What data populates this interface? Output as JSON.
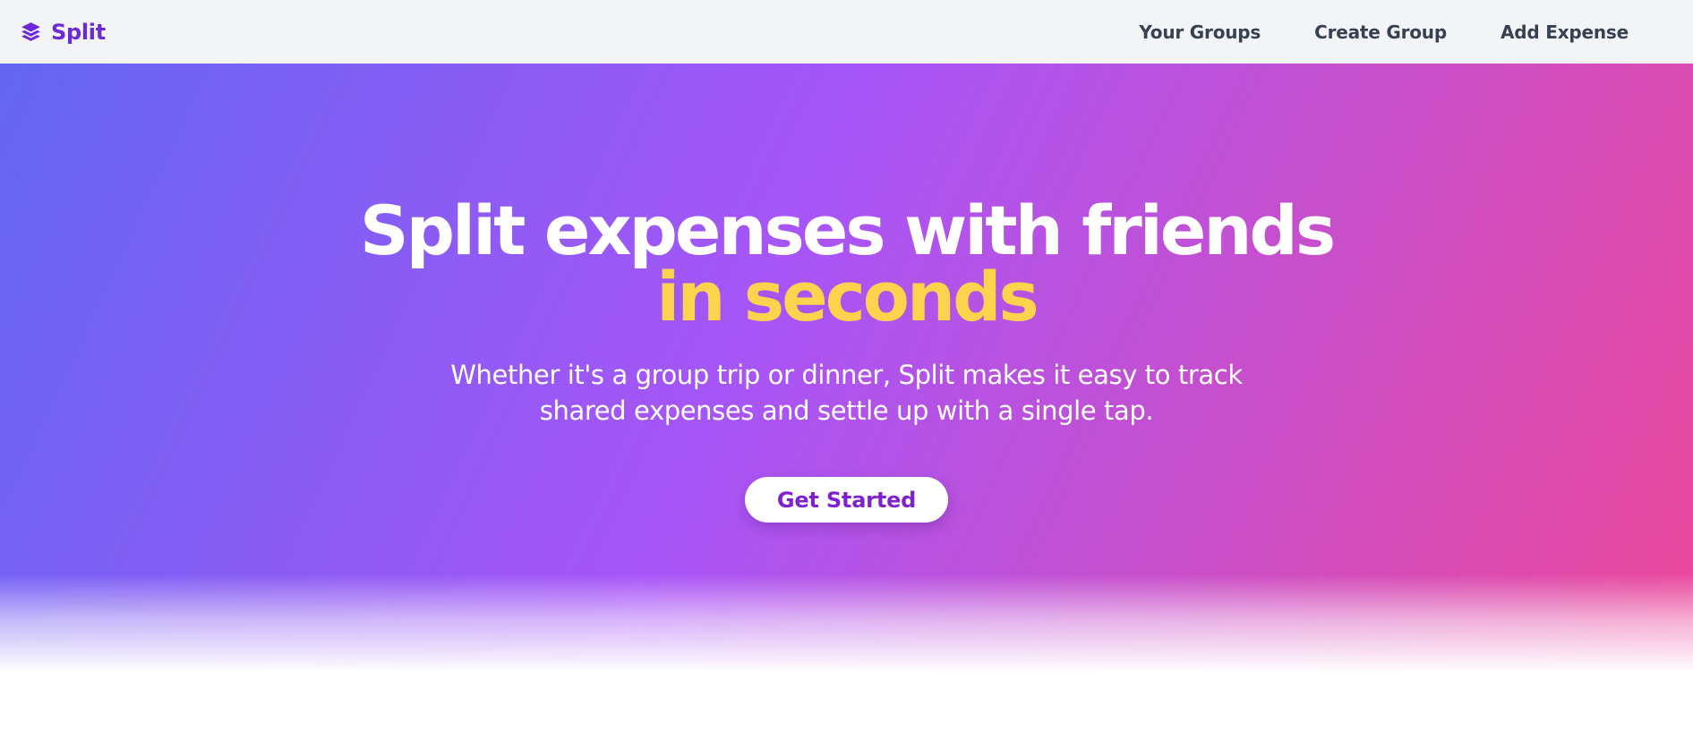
{
  "brand": {
    "name": "Split",
    "icon": "layers-icon",
    "color": "#6d28d9"
  },
  "nav": {
    "links": [
      {
        "label": "Your Groups"
      },
      {
        "label": "Create Group"
      },
      {
        "label": "Add Expense"
      }
    ]
  },
  "hero": {
    "title_line1": "Split expenses with friends",
    "title_line2": "in seconds",
    "subtitle": "Whether it's a group trip or dinner, Split makes it easy to track shared expenses and settle up with a single tap.",
    "cta_label": "Get Started",
    "accent_color": "#fcd34d",
    "gradient": [
      "#6366f1",
      "#a855f7",
      "#ec4899"
    ]
  }
}
